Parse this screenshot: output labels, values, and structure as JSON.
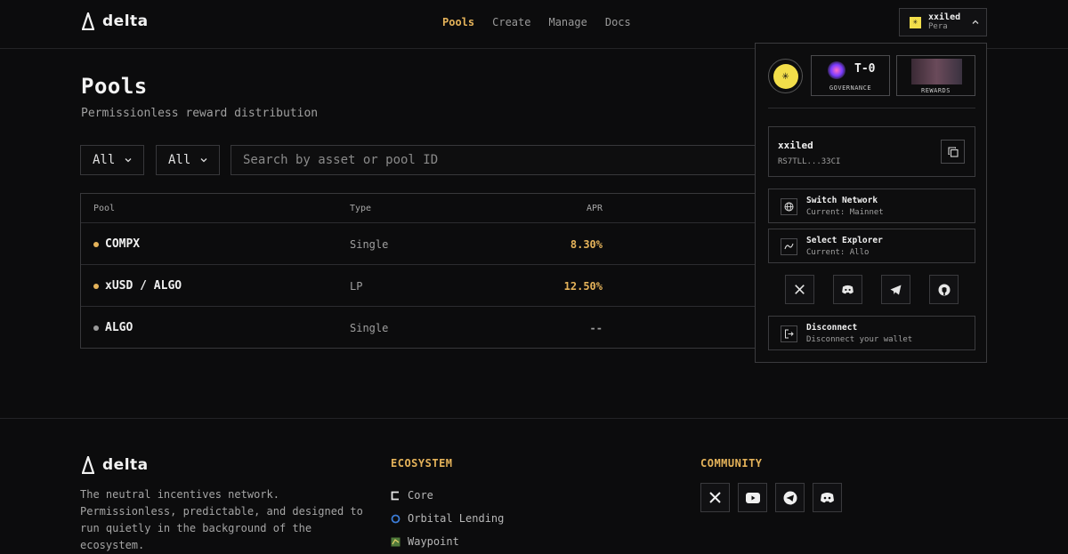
{
  "app": {
    "name": "delta"
  },
  "nav": {
    "items": [
      "Pools",
      "Create",
      "Manage",
      "Docs"
    ],
    "active": "Pools"
  },
  "wallet": {
    "name": "xxiled",
    "provider": "Pera"
  },
  "page": {
    "title": "Pools",
    "subtitle": "Permissionless reward distribution"
  },
  "filters": {
    "first": "All",
    "second": "All",
    "search_placeholder": "Search by asset or pool ID"
  },
  "table": {
    "headers": {
      "pool": "Pool",
      "type": "Type",
      "apr": "APR"
    },
    "rows": [
      {
        "pool": "COMPX",
        "type": "Single",
        "apr": "8.30%",
        "dot_color": "#e5b35a",
        "apr_color": "#e5b35a"
      },
      {
        "pool": "xUSD / ALGO",
        "type": "LP",
        "apr": "12.50%",
        "dot_color": "#e5b35a",
        "apr_color": "#e5b35a"
      },
      {
        "pool": "ALGO",
        "type": "Single",
        "apr": "--",
        "dot_color": "#9a9a9a",
        "apr_color": "#9a9a9a"
      }
    ]
  },
  "footer": {
    "logo": "delta",
    "description": "The neutral incentives network. Permissionless, predictable, and designed to run quietly in the background of the ecosystem.",
    "ecosystem": {
      "heading": "ECOSYSTEM",
      "items": [
        "Core",
        "Orbital Lending",
        "Waypoint"
      ]
    },
    "community": {
      "heading": "COMMUNITY",
      "icons": [
        "x-icon",
        "youtube-icon",
        "telegram-icon",
        "discord-icon"
      ]
    }
  },
  "dropdown": {
    "governance": {
      "tier": "T-0",
      "label": "GOVERNANCE"
    },
    "rewards": {
      "label": "REWARDS"
    },
    "account": {
      "name": "xxiled",
      "address": "RS7TLL...33CI"
    },
    "switch_network": {
      "title": "Switch Network",
      "sub": "Current: Mainnet"
    },
    "select_explorer": {
      "title": "Select Explorer",
      "sub": "Current: Allo"
    },
    "socials": [
      "x-icon",
      "discord-icon",
      "telegram-icon",
      "github-icon"
    ],
    "disconnect": {
      "title": "Disconnect",
      "sub": "Disconnect your wallet"
    }
  },
  "colors": {
    "accent": "#e5b35a",
    "background": "#0c0c0d",
    "border": "#38383b"
  }
}
